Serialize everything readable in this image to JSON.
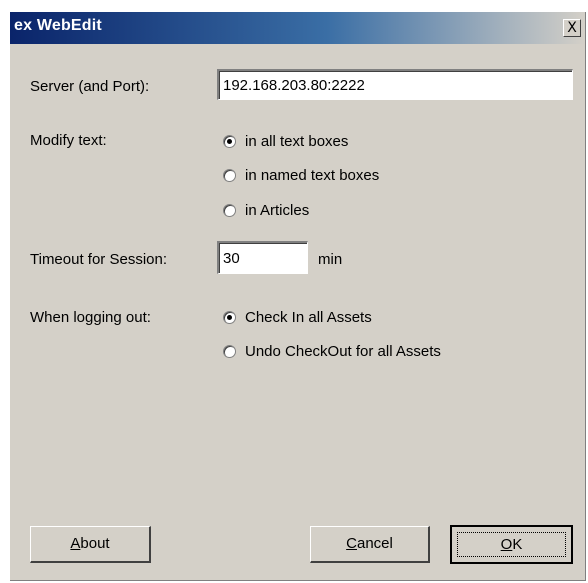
{
  "window": {
    "title": "ex WebEdit",
    "close_glyph": "X"
  },
  "server": {
    "label": "Server (and Port):",
    "value": "192.168.203.80:2222"
  },
  "modify": {
    "label": "Modify text:",
    "options": [
      {
        "label": "in all text boxes",
        "checked": true
      },
      {
        "label": "in named text boxes",
        "checked": false
      },
      {
        "label": "in Articles",
        "checked": false
      }
    ]
  },
  "timeout": {
    "label": "Timeout for Session:",
    "value": "30",
    "unit": "min"
  },
  "logout": {
    "label": "When logging out:",
    "options": [
      {
        "label": "Check In all Assets",
        "checked": true
      },
      {
        "label": "Undo CheckOut for all Assets",
        "checked": false
      }
    ]
  },
  "buttons": {
    "about": {
      "mnemonic": "A",
      "rest": "bout"
    },
    "cancel": {
      "mnemonic": "C",
      "rest": "ancel"
    },
    "ok": {
      "mnemonic": "O",
      "rest": "K"
    }
  }
}
